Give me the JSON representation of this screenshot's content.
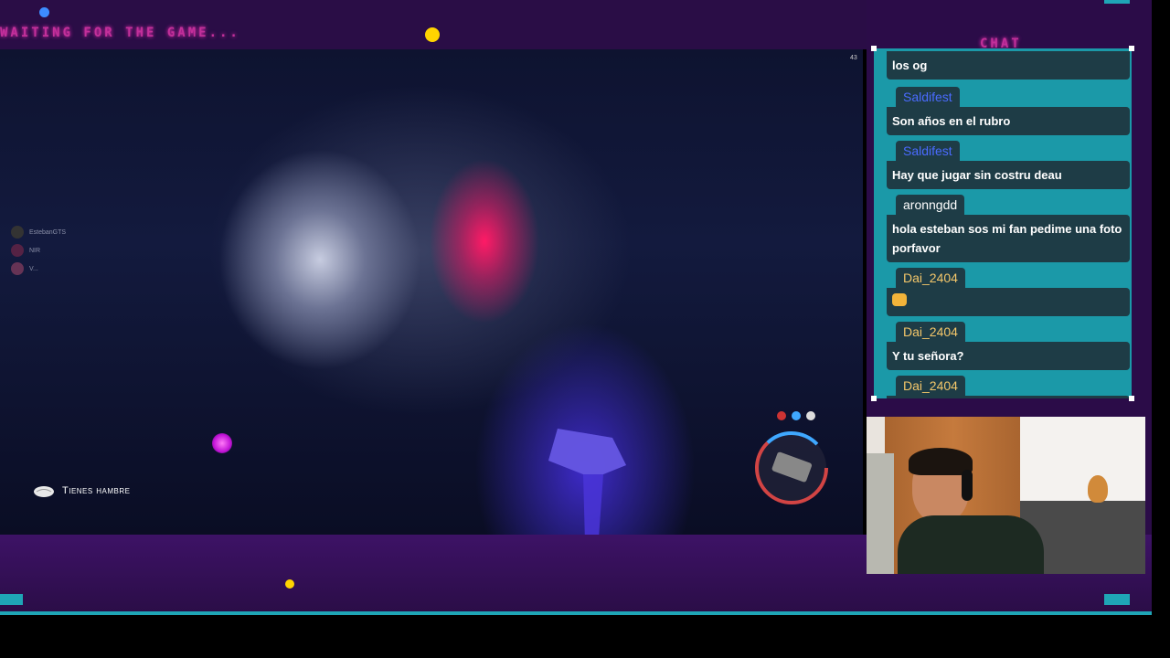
{
  "overlay": {
    "ticker_text": "WAITING FOR THE GAME...",
    "chat_title": "CHAT",
    "colors": {
      "frame": "#2a0d46",
      "accent_pink": "#c2309a",
      "chat_bg": "#1b99a8",
      "bubble": "#1e3c46"
    }
  },
  "game": {
    "hud": {
      "players": [
        {
          "name": "EstebanGTS"
        },
        {
          "name": "NIR"
        },
        {
          "name": "V..."
        }
      ],
      "status_text": "Tienes hambre",
      "status_icon": "brain-icon",
      "fps": "43"
    }
  },
  "chat": {
    "messages": [
      {
        "user": "",
        "text": "los og",
        "user_color": "#ffffff"
      },
      {
        "user": "Saldifest",
        "text": "Son años en el rubro",
        "user_color": "#4a6bff"
      },
      {
        "user": "Saldifest",
        "text": "Hay que jugar sin costru deau",
        "user_color": "#4a6bff"
      },
      {
        "user": "aronngdd",
        "text": "hola esteban sos mi fan pedime una foto porfavor",
        "user_color": "#ffffff"
      },
      {
        "user": "Dai_2404",
        "text": "",
        "emote": "cat-emote",
        "user_color": "#f4c76a"
      },
      {
        "user": "Dai_2404",
        "text": "Y tu señora?",
        "user_color": "#f4c76a"
      },
      {
        "user": "Dai_2404",
        "text": "",
        "emote": "alien-emote",
        "user_color": "#f4c76a"
      }
    ]
  },
  "webcam": {
    "label": "streamer-webcam"
  }
}
